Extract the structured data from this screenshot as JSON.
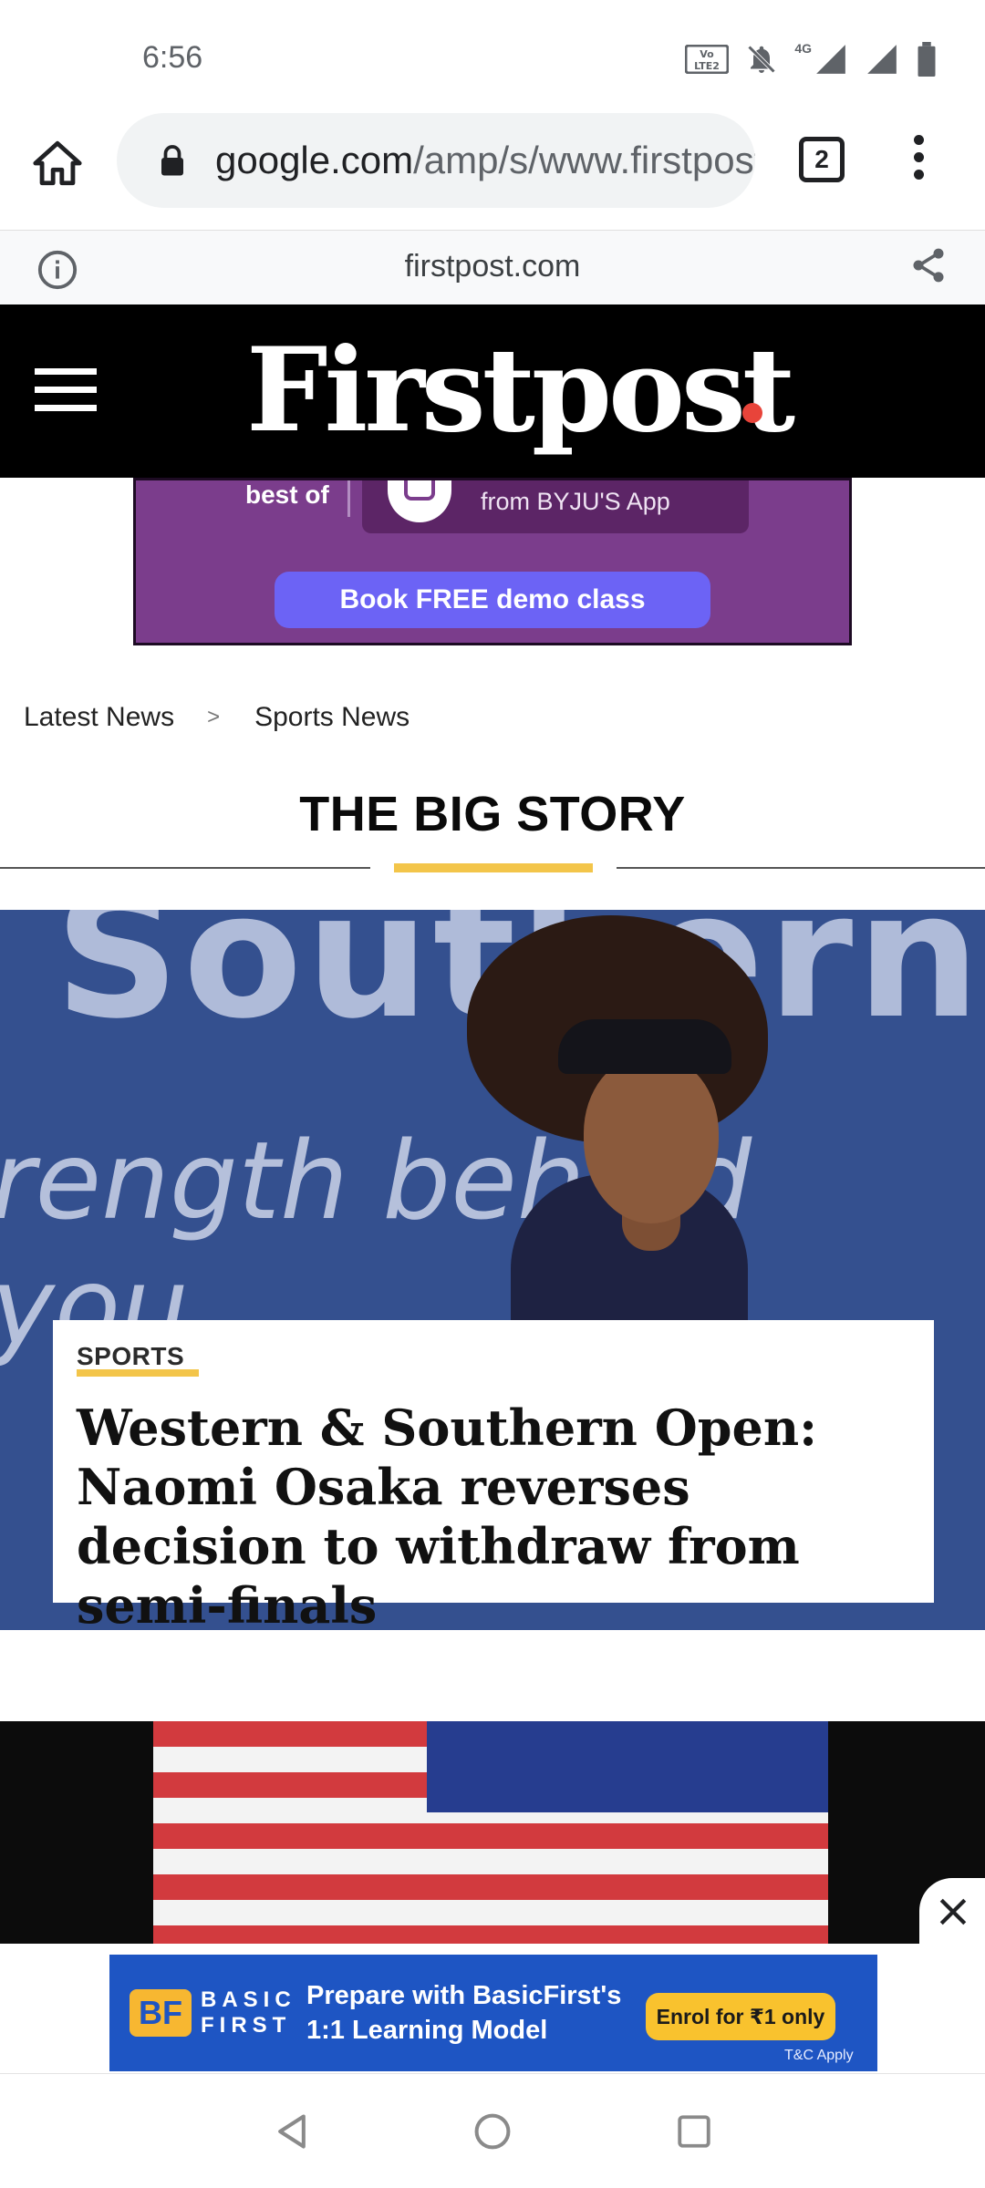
{
  "status_bar": {
    "time": "6:56",
    "network": "4G",
    "icons": [
      "volte-icon",
      "mute-bell-icon",
      "signal-icon",
      "signal-icon",
      "battery-icon"
    ]
  },
  "browser": {
    "url_host": "google.com",
    "url_path": "/amp/s/www.firstpost.com",
    "tab_count": "2",
    "amp_domain": "firstpost.com"
  },
  "site": {
    "logo": "Firstpost",
    "logo_dot_color": "#e8443a"
  },
  "top_ad": {
    "text_left": "best of",
    "app_text": "from BYJU'S App",
    "cta": "Book FREE demo class"
  },
  "breadcrumb": {
    "items": [
      "Latest News",
      "Sports News"
    ],
    "separator": ">"
  },
  "big_story": {
    "section_title": "THE BIG STORY",
    "accent_color": "#f3c54a",
    "image_text_1": "Southern",
    "image_text_2": "rength behind you.",
    "category": "SPORTS",
    "headline": "Western & Southern Open: Naomi Osaka reverses decision to withdraw from semi-finals"
  },
  "bottom_ad": {
    "logo_mark": "BF",
    "brand": "BASIC FIRST",
    "line": "Prepare with BasicFirst's 1:1 Learning Model",
    "cta": "Enrol for ₹1 only",
    "tc": "T&C Apply"
  }
}
